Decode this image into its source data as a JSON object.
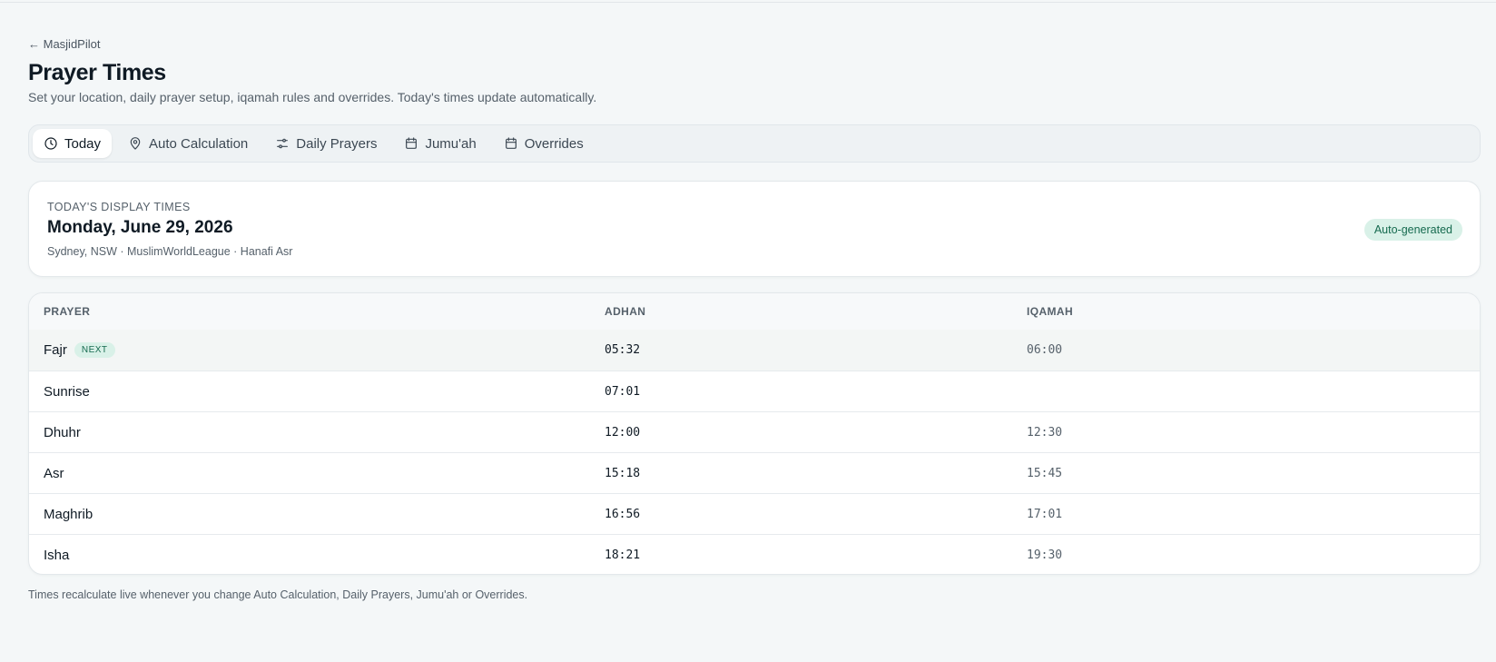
{
  "back_link": "← MasjidPilot",
  "title": "Prayer Times",
  "subtitle": "Set your location, daily prayer setup, iqamah rules and overrides. Today's times update automatically.",
  "tabs": [
    {
      "label": "Today",
      "icon": "clock-icon",
      "active": true
    },
    {
      "label": "Auto Calculation",
      "icon": "map-pin-icon",
      "active": false
    },
    {
      "label": "Daily Prayers",
      "icon": "sliders-icon",
      "active": false
    },
    {
      "label": "Jumu'ah",
      "icon": "calendar-icon",
      "active": false
    },
    {
      "label": "Overrides",
      "icon": "calendar-icon",
      "active": false
    }
  ],
  "today_card": {
    "kicker": "TODAY'S DISPLAY TIMES",
    "date": "Monday, June 29, 2026",
    "meta": "Sydney, NSW · MuslimWorldLeague · Hanafi Asr",
    "badge": "Auto-generated"
  },
  "table": {
    "headers": [
      "PRAYER",
      "ADHAN",
      "IQAMAH"
    ],
    "next_label": "NEXT",
    "rows": [
      {
        "prayer": "Fajr",
        "adhan": "05:32",
        "iqamah": "06:00",
        "next": true
      },
      {
        "prayer": "Sunrise",
        "adhan": "07:01",
        "iqamah": "",
        "next": false
      },
      {
        "prayer": "Dhuhr",
        "adhan": "12:00",
        "iqamah": "12:30",
        "next": false
      },
      {
        "prayer": "Asr",
        "adhan": "15:18",
        "iqamah": "15:45",
        "next": false
      },
      {
        "prayer": "Maghrib",
        "adhan": "16:56",
        "iqamah": "17:01",
        "next": false
      },
      {
        "prayer": "Isha",
        "adhan": "18:21",
        "iqamah": "19:30",
        "next": false
      }
    ]
  },
  "footer_note": "Times recalculate live whenever you change Auto Calculation, Daily Prayers, Jumu'ah or Overrides.",
  "colors": {
    "accent_bg": "#d9f1e8",
    "accent_text": "#166a4f",
    "page_bg": "#f4f7f8"
  }
}
